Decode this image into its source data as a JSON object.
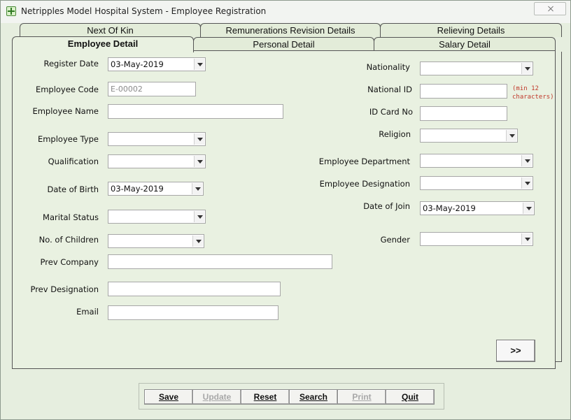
{
  "window": {
    "title": "Netripples Model Hospital System - Employee Registration"
  },
  "tabs": {
    "row1": [
      "Next Of Kin",
      "Remunerations Revision Details",
      "Relieving Details"
    ],
    "row2": [
      "Employee Detail",
      "Personal Detail",
      "Salary Detail"
    ],
    "active": "Employee Detail"
  },
  "left_form": {
    "register_date": {
      "label": "Register Date",
      "value": "03-May-2019"
    },
    "employee_code": {
      "label": "Employee Code",
      "value": "E-00002"
    },
    "employee_name": {
      "label": "Employee Name",
      "value": ""
    },
    "employee_type": {
      "label": "Employee Type",
      "value": ""
    },
    "qualification": {
      "label": "Qualification",
      "value": ""
    },
    "date_of_birth": {
      "label": "Date of Birth",
      "value": "03-May-2019"
    },
    "marital_status": {
      "label": "Marital Status",
      "value": ""
    },
    "no_of_children": {
      "label": "No. of Children",
      "value": ""
    },
    "prev_company": {
      "label": "Prev Company",
      "value": ""
    },
    "prev_designation": {
      "label": "Prev Designation",
      "value": ""
    },
    "email": {
      "label": "Email",
      "value": ""
    }
  },
  "right_form": {
    "nationality": {
      "label": "Nationality",
      "value": ""
    },
    "national_id": {
      "label": "National ID",
      "value": "",
      "hint": "(min 12\ncharacters)"
    },
    "id_card_no": {
      "label": "ID Card No",
      "value": ""
    },
    "religion": {
      "label": "Religion",
      "value": ""
    },
    "employee_department": {
      "label": "Employee Department",
      "value": ""
    },
    "employee_designation": {
      "label": "Employee Designation",
      "value": ""
    },
    "date_of_join": {
      "label": "Date of Join",
      "value": "03-May-2019"
    },
    "gender": {
      "label": "Gender",
      "value": ""
    }
  },
  "next_button": ">>",
  "toolbar": {
    "save": "Save",
    "update": "Update",
    "reset": "Reset",
    "search": "Search",
    "print": "Print",
    "quit": "Quit"
  },
  "colors": {
    "hint": "#c0392b",
    "panel": "#e9f1e1",
    "disabled_text": "#a8a8a8"
  },
  "icons": [
    "app-icon",
    "close-icon",
    "dropdown-arrow-icon"
  ]
}
